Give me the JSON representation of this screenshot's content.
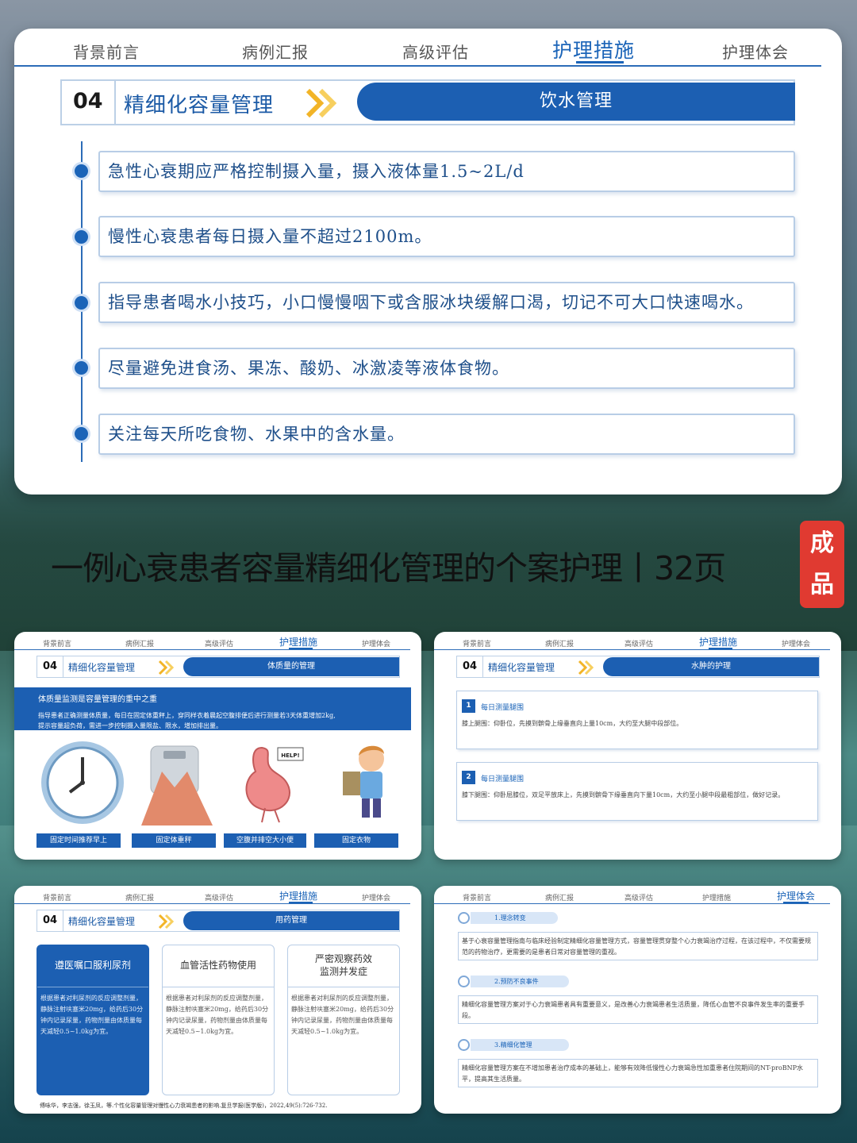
{
  "nav": [
    "背景前言",
    "病例汇报",
    "高级评估",
    "护理措施",
    "护理体会"
  ],
  "big_slide": {
    "num": "04",
    "title": "精细化容量管理",
    "tab": "饮水管理",
    "bullets": [
      "急性心衰期应严格控制摄入量，摄入液体量1.5~2L/d",
      "慢性心衰患者每日摄入量不超过2100m。",
      "指导患者喝水小技巧，小口慢慢咽下或含服冰块缓解口渴，切记不可大口快速喝水。",
      "尽量避免进食汤、果冻、酸奶、冰激凌等液体食物。",
      "关注每天所吃食物、水果中的含水量。"
    ]
  },
  "main_title": "一例心衰患者容量精细化管理的个案护理丨32页",
  "badge": [
    "成",
    "品"
  ],
  "slide_weight": {
    "num": "04",
    "title": "精细化容量管理",
    "tab": "体质量的管理",
    "band_title": "体质量监测是容量管理的重中之重",
    "band_text_1": "指导患者正确测量体质量，每日在固定体重秤上，穿同样衣着晨起空腹排便后进行测量若3天体重增加2kg,",
    "band_text_2": "提示容量超负荷，需进一步控制摄入量限盐、限水，增加排出量。",
    "tags": [
      "固定时间推荐早上",
      "固定体重秤",
      "空腹并排空大小便",
      "固定衣物"
    ],
    "help": "HELP!"
  },
  "slide_edema": {
    "num": "04",
    "title": "精细化容量管理",
    "tab": "水肿的护理",
    "items": [
      {
        "n": "1",
        "label": "每日测量腿围",
        "text": "膝上腿围：仰卧位，先摸到髌骨上缘垂直向上量10cm，大约至大腿中段部位。"
      },
      {
        "n": "2",
        "label": "每日测量腿围",
        "text": "膝下腿围：仰卧屈膝位，双足平放床上，先摸到髌骨下缘垂直向下量10cm，大约至小腿中段最粗部位，做好记录。"
      }
    ]
  },
  "slide_med": {
    "num": "04",
    "title": "精细化容量管理",
    "tab": "用药管理",
    "cols": [
      {
        "head": "遵医嘱口服利尿剂",
        "body": "根据患者对利尿剂的反应调整剂量，静脉注射呋塞米20mg，给药后30分钟内记录尿量，药物剂量由体质量每天减轻0.5~1.0kg为宜。"
      },
      {
        "head": "血管活性药物使用",
        "body": "根据患者对利尿剂的反应调整剂量，静脉注射呋塞米20mg，给药后30分钟内记录尿量，药物剂量由体质量每天减轻0.5~1.0kg为宜。"
      },
      {
        "head": "严密观察药效\n监测并发症",
        "body": "根据患者对利尿剂的反应调整剂量，静脉注射呋塞米20mg，给药后30分钟内记录尿量，药物剂量由体质量每天减轻0.5~1.0kg为宜。"
      }
    ],
    "ref": "傅咏华，李志强，徐玉凤，等.个性化容量管理对慢性心力衰竭患者的影响.复旦学报(医学版)，2022,49(5):726-732."
  },
  "slide_exp": {
    "items": [
      {
        "label": "1.理念转变",
        "text": "基于心衰容量管理指南与临床经验制定精细化容量管理方式，容量管理贯穿整个心力衰竭治疗过程，在该过程中，不仅需要规范的药物治疗，更需要的是患者日常对容量管理的重视。"
      },
      {
        "label": "2.预防不良事件",
        "text": "精细化容量管理方案对于心力衰竭患者具有重要意义，是改善心力衰竭患者生活质量，降低心血管不良事件发生率的重要手段。"
      },
      {
        "label": "3.精细化管理",
        "text": "精细化容量管理方案在不增加患者治疗成本的基础上，能够有效降低慢性心力衰竭急性加重患者住院期间的NT-proBNP水平，提高其生活质量。"
      }
    ]
  },
  "colors": {
    "primary": "#1c5fb2",
    "accent_arrow": "#f2b427",
    "badge": "#e03a31"
  }
}
